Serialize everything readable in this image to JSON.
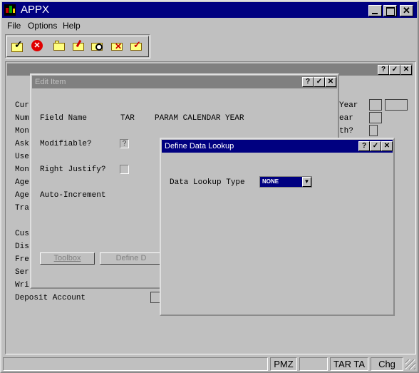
{
  "window": {
    "title": "APPX"
  },
  "menu": [
    "File",
    "Options",
    "Help"
  ],
  "toolbar_icons": [
    "check-icon",
    "cancel-icon",
    "new-folder-icon",
    "edit-folder-icon",
    "find-folder-icon",
    "delete-folder-icon",
    "scan-folder-icon"
  ],
  "mdi": {
    "labels_left": [
      "Cur",
      "Num",
      "Mon",
      "Ask",
      "Use",
      "Mon",
      "Age",
      "Age",
      "Tra",
      "",
      "Cus",
      "Dis",
      "Fre",
      "Ser",
      "Wri",
      "Deposit Account"
    ],
    "labels_right": [
      "Year",
      "ear",
      "th?"
    ]
  },
  "edit_item": {
    "title": "Edit Item",
    "field_name_label": "Field Name",
    "field_name_app": "TAR",
    "field_name_value": "PARAM CALENDAR YEAR",
    "modifiable_label": "Modifiable?",
    "modifiable_value": "?",
    "right_justify_label": "Right Justify?",
    "auto_increment_label": "Auto-Increment",
    "toolbox_button": "Toolbox",
    "define_button": "Define D"
  },
  "lookup": {
    "title": "Define Data Lookup",
    "type_label": "Data Lookup Type",
    "type_value": "NONE"
  },
  "status_bar": [
    "PMZ",
    "TAR TA",
    "Chg"
  ]
}
